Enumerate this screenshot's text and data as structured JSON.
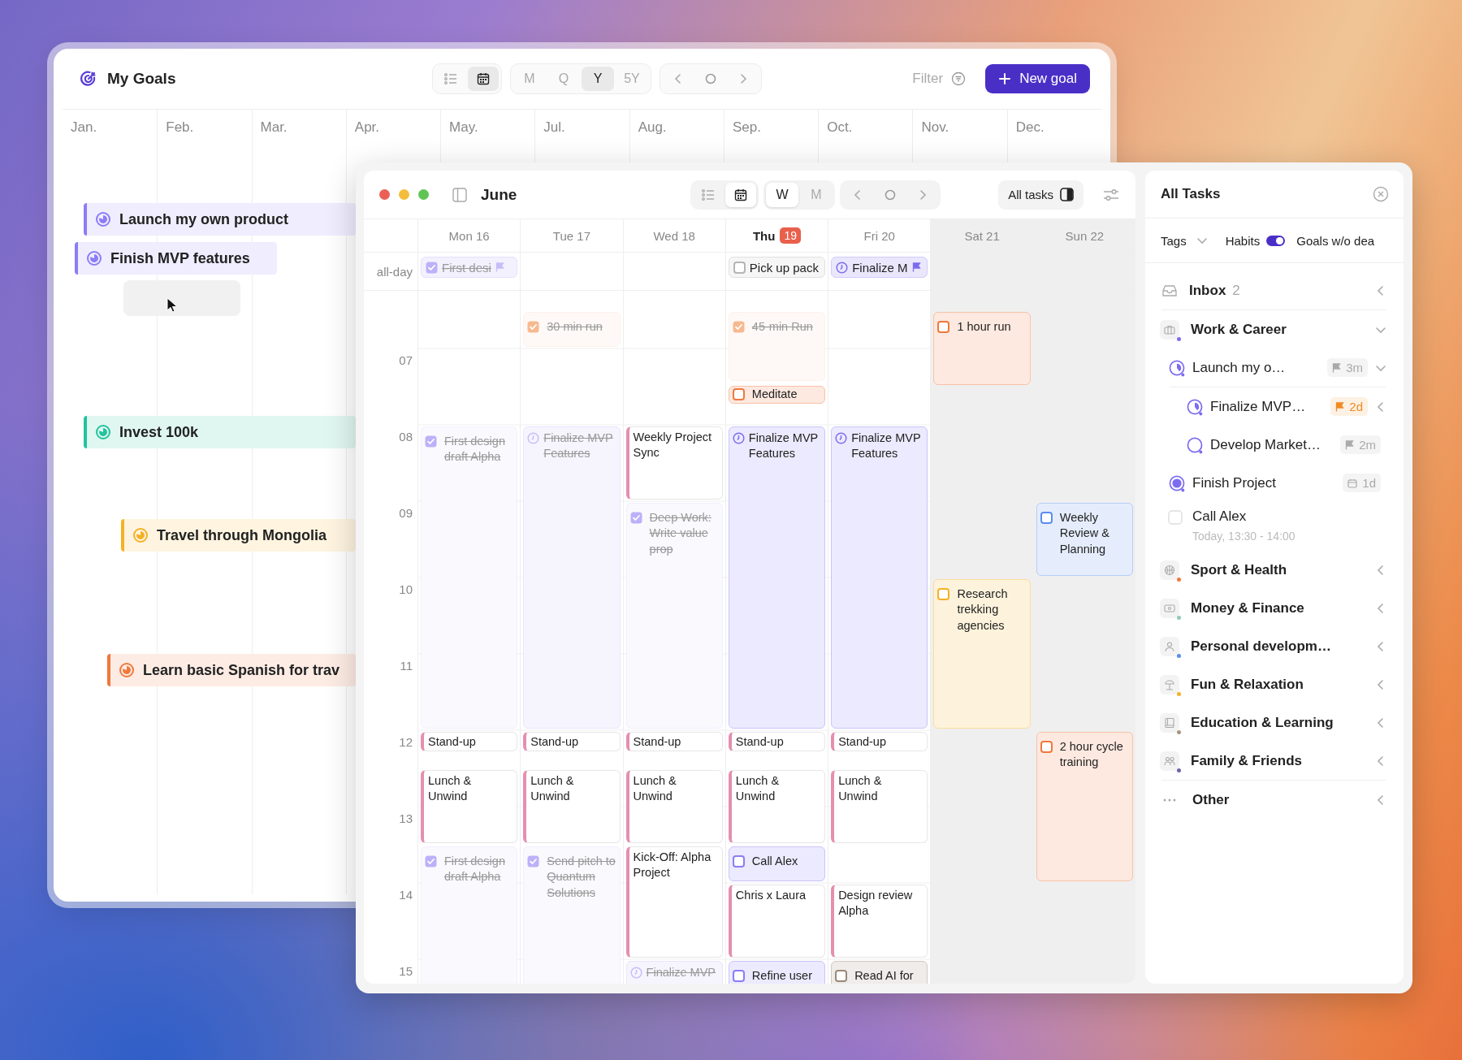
{
  "goals_window": {
    "title": "My Goals",
    "views": [
      {
        "kind": "list",
        "selected": false
      },
      {
        "kind": "calendar",
        "selected": true
      }
    ],
    "periods": [
      {
        "label": "M",
        "selected": false
      },
      {
        "label": "Q",
        "selected": false
      },
      {
        "label": "Y",
        "selected": true
      },
      {
        "label": "5Y",
        "selected": false
      }
    ],
    "filter": "Filter",
    "new_goal": "New goal",
    "months": [
      "Jan.",
      "Feb.",
      "Mar.",
      "Apr.",
      "May.",
      "Jul.",
      "Aug.",
      "Sep.",
      "Oct.",
      "Nov.",
      "Dec."
    ],
    "goals": [
      {
        "title": "Launch my own product",
        "color": "#8b7cf6"
      },
      {
        "title": "Finish MVP features",
        "color": "#8b7cf6"
      },
      {
        "title": "Invest 100k",
        "color": "#22c39c"
      },
      {
        "title": "Travel through Mongolia",
        "color": "#f5b125"
      },
      {
        "title": "Learn basic Spanish for trav",
        "color": "#f0783c"
      }
    ]
  },
  "calendar_window": {
    "title": "June",
    "views": [
      {
        "kind": "list",
        "selected": false
      },
      {
        "kind": "calendar",
        "selected": true
      }
    ],
    "periods": [
      {
        "label": "W",
        "selected": true
      },
      {
        "label": "M",
        "selected": false
      }
    ],
    "all_tasks_button": "All tasks",
    "all_day_label": "all-day",
    "hours": [
      "07",
      "08",
      "09",
      "10",
      "11",
      "12",
      "13",
      "14",
      "15"
    ],
    "days": [
      {
        "name": "Mon",
        "date": "16",
        "today": false,
        "weekend": false,
        "all_day": [
          {
            "kind": "task",
            "title": "First desi",
            "done": true,
            "flagged": true,
            "color": "#bcb1f8"
          }
        ],
        "events": [
          {
            "kind": "task",
            "title": "First design draft Alpha",
            "done": true,
            "color": "#bcb1f8"
          },
          {
            "kind": "event",
            "title": "Stand-up"
          },
          {
            "kind": "event",
            "title": "Lunch & Unwind"
          },
          {
            "kind": "task",
            "title": "First design draft Alpha",
            "done": true,
            "color": "#bcb1f8"
          }
        ]
      },
      {
        "name": "Tue",
        "date": "17",
        "today": false,
        "weekend": false,
        "events": [
          {
            "kind": "task",
            "title": "30 min run",
            "done": true,
            "color": "#f7b98f"
          },
          {
            "kind": "goal",
            "title": "Finalize MVP Features",
            "done": true
          },
          {
            "kind": "event",
            "title": "Stand-up"
          },
          {
            "kind": "event",
            "title": "Lunch & Unwind"
          },
          {
            "kind": "task",
            "title": "Send pitch to Quantum Solutions",
            "done": true,
            "color": "#bcb1f8"
          }
        ]
      },
      {
        "name": "Wed",
        "date": "18",
        "today": false,
        "weekend": false,
        "events": [
          {
            "kind": "event",
            "title": "Weekly Project Sync"
          },
          {
            "kind": "task",
            "title": "Deep Work: Write value prop",
            "done": true,
            "color": "#bcb1f8"
          },
          {
            "kind": "event",
            "title": "Stand-up"
          },
          {
            "kind": "event",
            "title": "Lunch & Unwind"
          },
          {
            "kind": "event",
            "title": "Kick-Off: Alpha Project"
          },
          {
            "kind": "goal",
            "title": "Finalize MVP",
            "done": true
          }
        ]
      },
      {
        "name": "Thu",
        "date": "19",
        "today": true,
        "weekend": false,
        "all_day": [
          {
            "kind": "task",
            "title": "Pick up pack",
            "done": false,
            "flagged": false,
            "color": "#b5b5b5"
          }
        ],
        "events": [
          {
            "kind": "task",
            "title": "45-min Run",
            "done": true,
            "color": "#f7b98f"
          },
          {
            "kind": "task",
            "title": "Meditate",
            "done": false,
            "color": "#f0783c"
          },
          {
            "kind": "goal",
            "title": "Finalize MVP Features",
            "done": false
          },
          {
            "kind": "event",
            "title": "Stand-up"
          },
          {
            "kind": "event",
            "title": "Lunch & Unwind"
          },
          {
            "kind": "task",
            "title": "Call Alex",
            "done": false,
            "color": "#8b7cf6"
          },
          {
            "kind": "event",
            "title": "Chris x Laura"
          },
          {
            "kind": "task",
            "title": "Refine user",
            "done": false,
            "color": "#8b7cf6"
          }
        ]
      },
      {
        "name": "Fri",
        "date": "20",
        "today": false,
        "weekend": false,
        "all_day": [
          {
            "kind": "goal",
            "title": "Finalize M",
            "done": false,
            "flagged": true
          }
        ],
        "events": [
          {
            "kind": "goal",
            "title": "Finalize MVP Features",
            "done": false
          },
          {
            "kind": "event",
            "title": "Stand-up"
          },
          {
            "kind": "event",
            "title": "Lunch & Unwind"
          },
          {
            "kind": "event",
            "title": "Design review Alpha"
          },
          {
            "kind": "task",
            "title": "Read AI for",
            "done": false,
            "color": "#9a8a78"
          }
        ]
      },
      {
        "name": "Sat",
        "date": "21",
        "today": false,
        "weekend": true,
        "events": [
          {
            "kind": "task",
            "title": "1 hour run",
            "done": false,
            "color": "#f0783c"
          },
          {
            "kind": "task",
            "title": "Research trekking agencies",
            "done": false,
            "color": "#f5b125"
          }
        ]
      },
      {
        "name": "Sun",
        "date": "22",
        "today": false,
        "weekend": true,
        "events": [
          {
            "kind": "task",
            "title": "Weekly Review & Planning",
            "done": false,
            "color": "#5b8def"
          },
          {
            "kind": "task",
            "title": "2 hour cycle training",
            "done": false,
            "color": "#f0783c"
          }
        ]
      }
    ]
  },
  "tasks_panel": {
    "title": "All Tasks",
    "tags": "Tags",
    "habits": {
      "label": "Habits",
      "on": true
    },
    "goals_filter": "Goals w/o dea",
    "inbox": {
      "label": "Inbox",
      "count": "2",
      "expanded": false
    },
    "categories": [
      {
        "kind": "work",
        "name": "Work & Career",
        "color": "#7c6cf0",
        "expanded": true,
        "items": [
          {
            "kind": "goal",
            "title": "Launch my o…",
            "started": true,
            "badge": {
              "kind": "deadline",
              "text": "3m",
              "urgent": false
            },
            "expanded": true,
            "children": [
              {
                "kind": "goal",
                "title": "Finalize MVP…",
                "started": true,
                "badge": {
                  "kind": "deadline",
                  "text": "2d",
                  "urgent": true
                },
                "expanded": false
              },
              {
                "kind": "goal",
                "title": "Develop Market…",
                "started": false,
                "badge": {
                  "kind": "deadline",
                  "text": "2m",
                  "urgent": false
                }
              }
            ]
          },
          {
            "kind": "project",
            "title": "Finish Project",
            "badge": {
              "kind": "date",
              "text": "1d",
              "urgent": false
            }
          },
          {
            "kind": "task",
            "title": "Call Alex",
            "time": "Today, 13:30 - 14:00",
            "checked": false
          }
        ]
      },
      {
        "kind": "sport",
        "name": "Sport & Health",
        "color": "#f0783c",
        "expanded": false
      },
      {
        "kind": "money",
        "name": "Money & Finance",
        "color": "#8fcab8",
        "expanded": false
      },
      {
        "kind": "personal",
        "name": "Personal developm…",
        "color": "#5b8def",
        "expanded": false
      },
      {
        "kind": "fun",
        "name": "Fun & Relaxation",
        "color": "#f5b125",
        "expanded": false
      },
      {
        "kind": "education",
        "name": "Education & Learning",
        "color": "#a89584",
        "expanded": false
      },
      {
        "kind": "family",
        "name": "Family & Friends",
        "color": "#6b63a8",
        "expanded": false
      }
    ],
    "other": {
      "label": "Other",
      "expanded": false
    }
  }
}
